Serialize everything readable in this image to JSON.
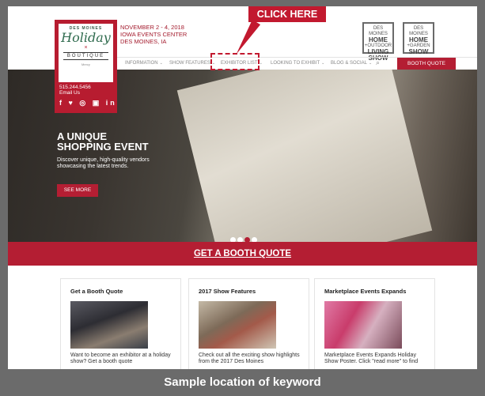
{
  "annotation": {
    "cta": "CLICK HERE",
    "caption": "Sample location of keyword"
  },
  "logo": {
    "top": "DES MOINES",
    "script": "Holiday",
    "mark": "×",
    "boutique": "BOUTIQUE",
    "sponsor": "Mercy"
  },
  "contact": {
    "phone": "515.244.5456",
    "email": "Email Us",
    "social": "f ♥ ◎ ▣ in"
  },
  "event": {
    "dates": "NOVEMBER 2 - 4, 2018",
    "venue": "IOWA EVENTS CENTER",
    "city": "DES MOINES, IA"
  },
  "partner_logos": [
    {
      "small": "DES MOINES",
      "big": "HOME",
      "mid": "+OUTDOOR",
      "big2": "LIVING",
      "big3": "SHOW"
    },
    {
      "small": "DES MOINES",
      "big": "HOME",
      "mid": "+GARDEN",
      "big2": "SHOW",
      "big3": ""
    }
  ],
  "nav": {
    "items": [
      {
        "label": "INFORMATION"
      },
      {
        "label": "SHOW FEATURES"
      },
      {
        "label": "EXHIBITOR LIST"
      },
      {
        "label": "LOOKING TO EXHIBIT"
      },
      {
        "label": "BLOG & SOCIAL"
      }
    ],
    "caret": "⌄",
    "search_icon": "⌕",
    "booth_button": "BOOTH QUOTE"
  },
  "hero": {
    "title_line1": "A UNIQUE",
    "title_line2": "SHOPPING EVENT",
    "sub_line1": "Discover unique, high-quality vendors",
    "sub_line2": "showcasing the latest trends.",
    "button": "SEE MORE"
  },
  "quote_bar": "GET A BOOTH QUOTE",
  "cards": [
    {
      "title": "Get a Booth Quote",
      "text": "Want to become an exhibitor at a holiday show? Get a booth quote"
    },
    {
      "title": "2017 Show Features",
      "text": "Check out all the exciting show highlights from the 2017 Des Moines"
    },
    {
      "title": "Marketplace Events Expands",
      "text": "Marketplace Events Expands Holiday Show Poster. Click \"read more\" to find"
    }
  ],
  "colors": {
    "brand_red": "#b41e33",
    "annotation_red": "#c2192f",
    "logo_green": "#2f6b4e"
  }
}
